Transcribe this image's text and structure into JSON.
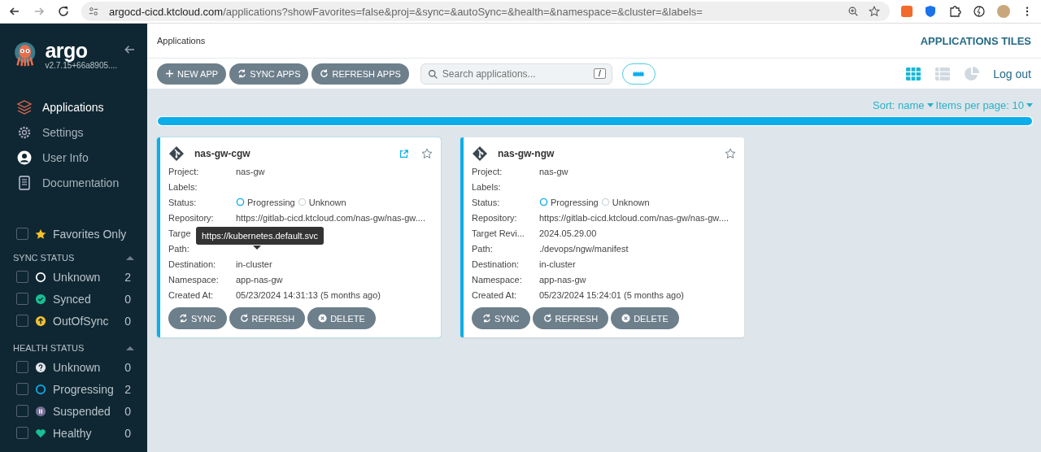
{
  "browser": {
    "url_host": "argocd-cicd.ktcloud.com",
    "url_path": "/applications?showFavorites=false&proj=&sync=&autoSync=&health=&namespace=&cluster=&labels="
  },
  "sidebar": {
    "logo": "argo",
    "version": "v2.7.15+66a8905....",
    "nav": [
      {
        "label": "Applications",
        "selected": true
      },
      {
        "label": "Settings",
        "selected": false
      },
      {
        "label": "User Info",
        "selected": false
      },
      {
        "label": "Documentation",
        "selected": false
      }
    ],
    "favorites": {
      "label": "Favorites Only",
      "checked": false
    },
    "groups": [
      {
        "title": "SYNC STATUS",
        "expanded": true,
        "items": [
          {
            "label": "Unknown",
            "count": "2",
            "color": "#ffffff",
            "checked": false
          },
          {
            "label": "Synced",
            "count": "0",
            "color": "#18be94",
            "checked": false
          },
          {
            "label": "OutOfSync",
            "count": "0",
            "color": "#f4c030",
            "checked": false
          }
        ]
      },
      {
        "title": "HEALTH STATUS",
        "expanded": true,
        "items": [
          {
            "label": "Unknown",
            "count": "0",
            "color": "#e2e7ea",
            "checked": false
          },
          {
            "label": "Progressing",
            "count": "2",
            "color": "#0dadea",
            "checked": false
          },
          {
            "label": "Suspended",
            "count": "0",
            "color": "#766f94",
            "checked": false
          },
          {
            "label": "Healthy",
            "count": "0",
            "color": "#18be94",
            "checked": false
          }
        ]
      }
    ]
  },
  "header": {
    "breadcrumb": "Applications",
    "title": "APPLICATIONS TILES"
  },
  "toolbar": {
    "buttons": [
      "NEW APP",
      "SYNC APPS",
      "REFRESH APPS"
    ],
    "search": {
      "placeholder": "Search applications...",
      "shortcut": "/"
    },
    "views": [
      {
        "kind": "tiles",
        "selected": true
      },
      {
        "kind": "list",
        "selected": false
      },
      {
        "kind": "summary",
        "selected": false
      }
    ],
    "logout": "Log out"
  },
  "sort": {
    "label": "Sort: name",
    "per_page": "Items per page: 10"
  },
  "progress": {
    "level": 1
  },
  "apps": [
    {
      "name": "nas-gw-cgw",
      "external_link": true,
      "favorite": false,
      "fields": [
        {
          "label": "Project:",
          "value": "nas-gw"
        },
        {
          "label": "Labels:"
        },
        {
          "label": "Status:",
          "kind": "status",
          "health": "Progressing",
          "sync": "Unknown"
        },
        {
          "label": "Repository:",
          "value": "https://gitlab-cicd.ktcloud.com/nas-gw/nas-gw...."
        },
        {
          "label": "Targe"
        },
        {
          "label": "Path:"
        },
        {
          "label": "Destination:",
          "value": "in-cluster"
        },
        {
          "label": "Namespace:",
          "value": "app-nas-gw"
        },
        {
          "label": "Created At:",
          "value": "05/23/2024 14:31:13  (5 months ago)"
        }
      ],
      "tooltip": "https://kubernetes.default.svc",
      "buttons": [
        "SYNC",
        "REFRESH",
        "DELETE"
      ]
    },
    {
      "name": "nas-gw-ngw",
      "external_link": false,
      "favorite": false,
      "fields": [
        {
          "label": "Project:",
          "value": "nas-gw"
        },
        {
          "label": "Labels:"
        },
        {
          "label": "Status:",
          "kind": "status",
          "health": "Progressing",
          "sync": "Unknown"
        },
        {
          "label": "Repository:",
          "value": "https://gitlab-cicd.ktcloud.com/nas-gw/nas-gw...."
        },
        {
          "label": "Target Revi...",
          "value": "2024.05.29.00"
        },
        {
          "label": "Path:",
          "value": "./devops/ngw/manifest"
        },
        {
          "label": "Destination:",
          "value": "in-cluster"
        },
        {
          "label": "Namespace:",
          "value": "app-nas-gw"
        },
        {
          "label": "Created At:",
          "value": "05/23/2024 15:24:01  (5 months ago)"
        }
      ],
      "buttons": [
        "SYNC",
        "REFRESH",
        "DELETE"
      ]
    }
  ]
}
